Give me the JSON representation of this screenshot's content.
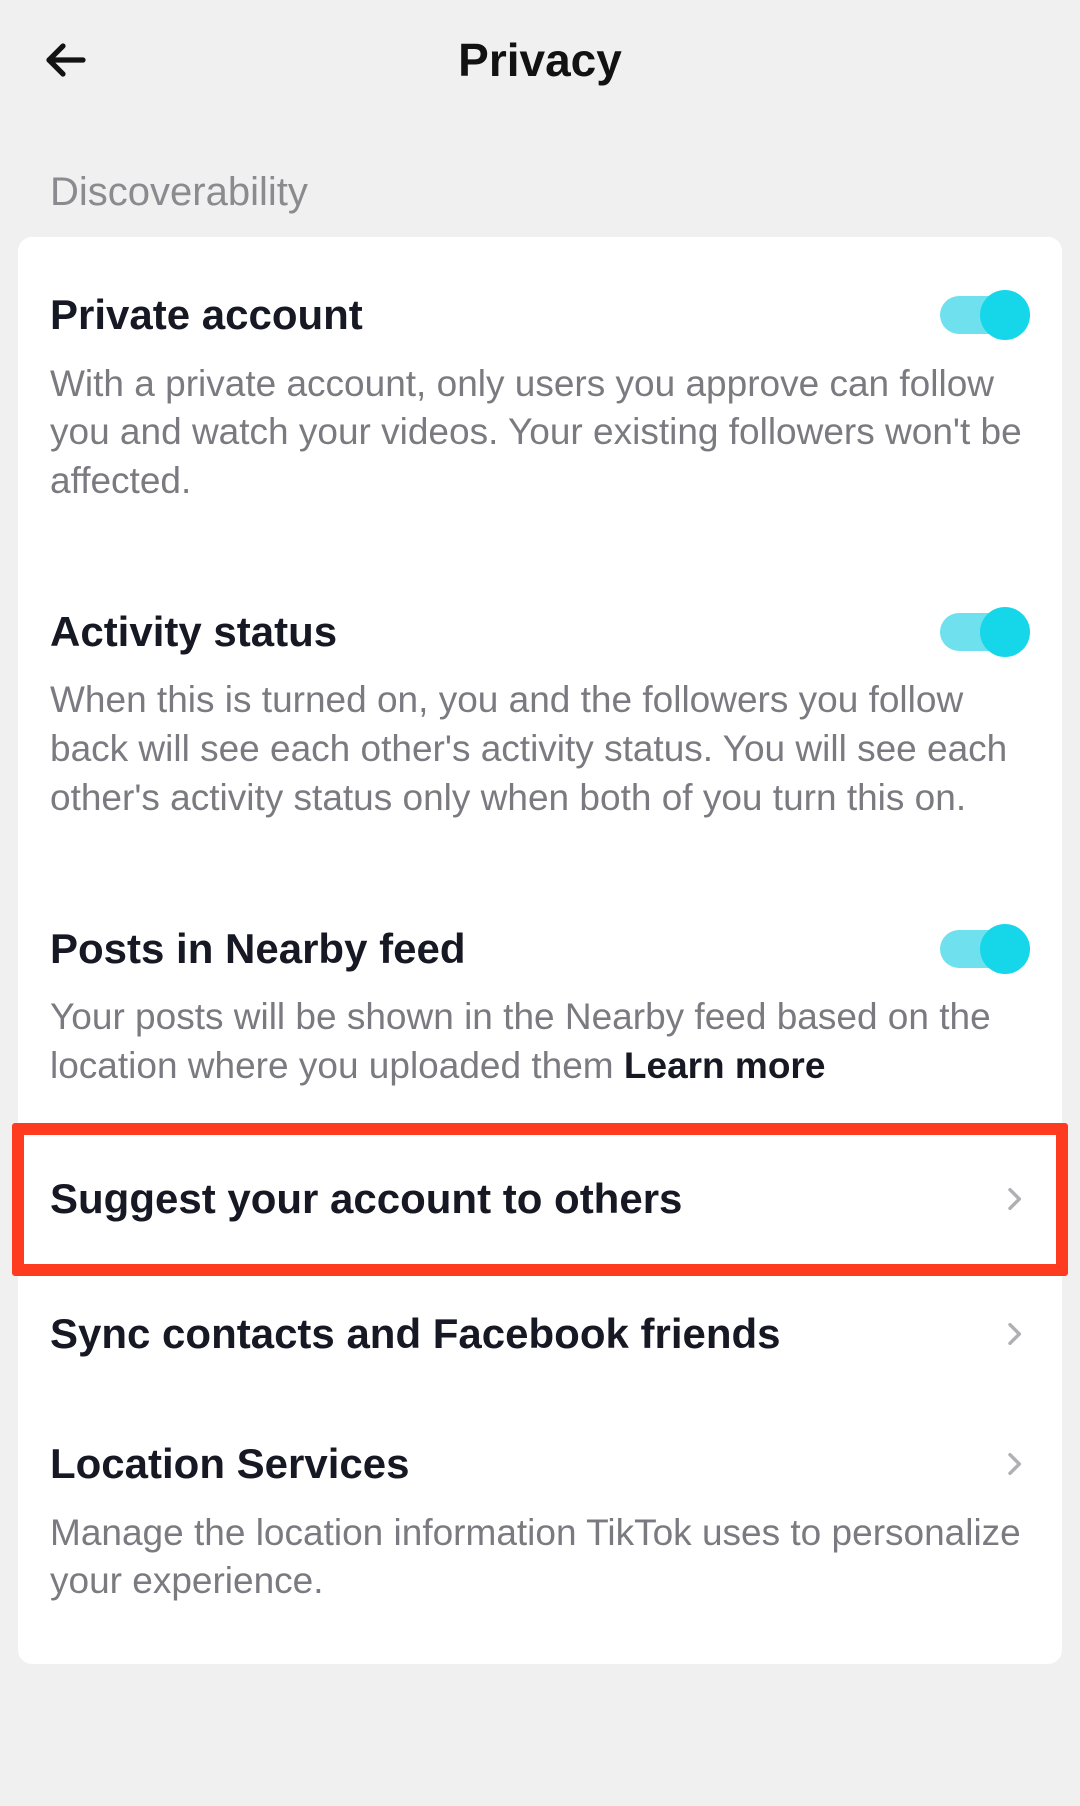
{
  "header": {
    "title": "Privacy"
  },
  "section_label": "Discoverability",
  "items": {
    "private_account": {
      "title": "Private account",
      "desc": "With a private account, only users you approve can follow you and watch your videos. Your existing followers won't be affected.",
      "on": true
    },
    "activity_status": {
      "title": "Activity status",
      "desc": "When this is turned on, you and the followers you follow back will see each other's activity status. You will see each other's activity status only when both of you turn this on.",
      "on": true
    },
    "nearby": {
      "title": "Posts in Nearby feed",
      "desc_prefix": "Your posts will be shown in the Nearby feed based on the location where you uploaded them ",
      "learn_more": "Learn more",
      "on": true
    },
    "suggest": {
      "title": "Suggest your account to others"
    },
    "sync": {
      "title": "Sync contacts and Facebook friends"
    },
    "location": {
      "title": "Location Services",
      "desc": "Manage the location information TikTok uses to personalize your experience."
    }
  },
  "colors": {
    "accent": "#16d6e9",
    "highlight": "#ff3b1f"
  }
}
